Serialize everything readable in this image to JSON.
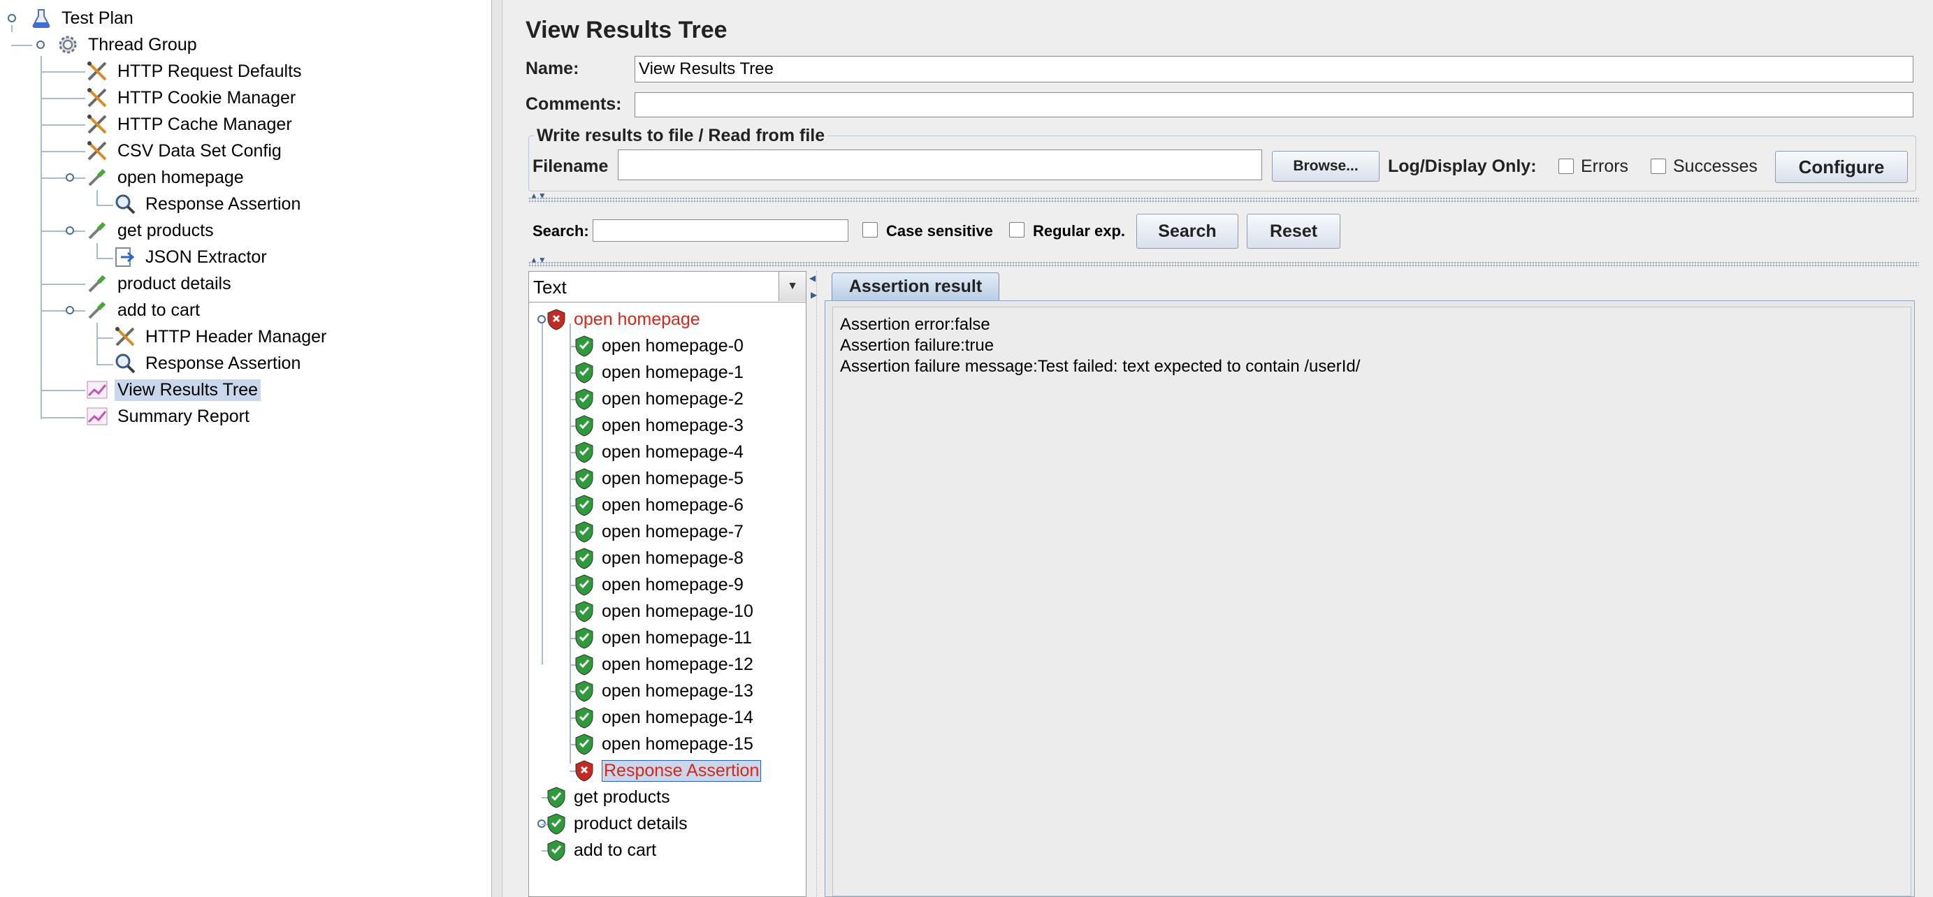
{
  "tree": {
    "items": [
      {
        "label": "Test Plan",
        "icon": "flask-icon",
        "name": "tree-item-test-plan"
      },
      {
        "label": "Thread Group",
        "icon": "gear-icon",
        "name": "tree-item-thread-group"
      },
      {
        "label": "HTTP Request Defaults",
        "icon": "wrench-screwdriver-icon",
        "name": "tree-item-http-request-defaults"
      },
      {
        "label": "HTTP Cookie Manager",
        "icon": "wrench-screwdriver-icon",
        "name": "tree-item-http-cookie-manager"
      },
      {
        "label": "HTTP Cache Manager",
        "icon": "wrench-screwdriver-icon",
        "name": "tree-item-http-cache-manager"
      },
      {
        "label": "CSV Data Set Config",
        "icon": "wrench-screwdriver-icon",
        "name": "tree-item-csv-data-set-config"
      },
      {
        "label": "open homepage",
        "icon": "pipette-icon",
        "name": "tree-item-open-homepage"
      },
      {
        "label": "Response Assertion",
        "icon": "magnifier-icon",
        "name": "tree-item-response-assertion"
      },
      {
        "label": "get products",
        "icon": "pipette-icon",
        "name": "tree-item-get-products"
      },
      {
        "label": "JSON Extractor",
        "icon": "extractor-arrow-icon",
        "name": "tree-item-json-extractor"
      },
      {
        "label": "product details",
        "icon": "pipette-icon",
        "name": "tree-item-product-details"
      },
      {
        "label": "add to cart",
        "icon": "pipette-icon",
        "name": "tree-item-add-to-cart"
      },
      {
        "label": "HTTP Header Manager",
        "icon": "wrench-screwdriver-icon",
        "name": "tree-item-http-header-manager"
      },
      {
        "label": "Response Assertion",
        "icon": "magnifier-icon",
        "name": "tree-item-response-assertion-2"
      },
      {
        "label": "View Results Tree",
        "icon": "graph-icon",
        "name": "tree-item-view-results-tree"
      },
      {
        "label": "Summary Report",
        "icon": "graph-icon",
        "name": "tree-item-summary-report"
      }
    ]
  },
  "panel": {
    "title": "View Results Tree",
    "name_label": "Name:",
    "name_value": "View Results Tree",
    "comments_label": "Comments:",
    "comments_value": "",
    "file_section_title": "Write results to file / Read from file",
    "filename_label": "Filename",
    "filename_value": "",
    "browse_label": "Browse...",
    "log_display_label": "Log/Display Only:",
    "errors_label": "Errors",
    "successes_label": "Successes",
    "configure_label": "Configure"
  },
  "search": {
    "label": "Search:",
    "value": "",
    "case_sensitive_label": "Case sensitive",
    "regex_label": "Regular exp.",
    "search_button": "Search",
    "reset_button": "Reset"
  },
  "results": {
    "renderer": "Text",
    "items": [
      {
        "label": "open homepage",
        "status": "error"
      },
      {
        "label": "open homepage-0",
        "status": "ok"
      },
      {
        "label": "open homepage-1",
        "status": "ok"
      },
      {
        "label": "open homepage-2",
        "status": "ok"
      },
      {
        "label": "open homepage-3",
        "status": "ok"
      },
      {
        "label": "open homepage-4",
        "status": "ok"
      },
      {
        "label": "open homepage-5",
        "status": "ok"
      },
      {
        "label": "open homepage-6",
        "status": "ok"
      },
      {
        "label": "open homepage-7",
        "status": "ok"
      },
      {
        "label": "open homepage-8",
        "status": "ok"
      },
      {
        "label": "open homepage-9",
        "status": "ok"
      },
      {
        "label": "open homepage-10",
        "status": "ok"
      },
      {
        "label": "open homepage-11",
        "status": "ok"
      },
      {
        "label": "open homepage-12",
        "status": "ok"
      },
      {
        "label": "open homepage-13",
        "status": "ok"
      },
      {
        "label": "open homepage-14",
        "status": "ok"
      },
      {
        "label": "open homepage-15",
        "status": "ok"
      },
      {
        "label": "Response Assertion",
        "status": "error"
      },
      {
        "label": "get products",
        "status": "ok"
      },
      {
        "label": "product details",
        "status": "ok"
      },
      {
        "label": "add to cart",
        "status": "ok"
      }
    ]
  },
  "detail": {
    "tab_label": "Assertion result",
    "lines": [
      "Assertion error:false",
      "Assertion failure:true",
      "Assertion failure message:Test failed: text expected to contain /userId/"
    ]
  },
  "colors": {
    "error_text": "#d6281c",
    "selection": "#c8d7ec",
    "ok_badge": "#2e9a3a",
    "error_badge": "#c42a22"
  }
}
